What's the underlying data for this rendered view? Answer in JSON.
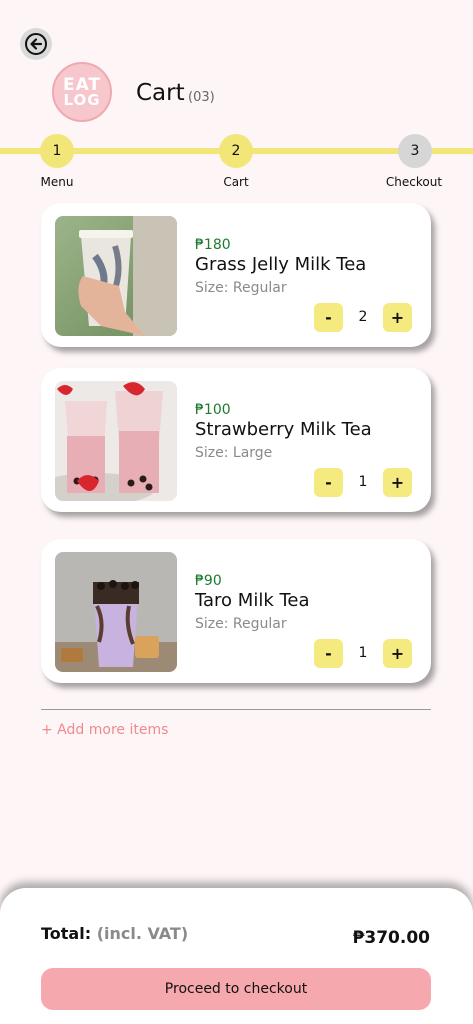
{
  "header": {
    "back_icon": "arrow-left-icon",
    "logo_line1": "EAT",
    "logo_line2": "LOG",
    "title": "Cart",
    "count": "(03)"
  },
  "steps": [
    {
      "number": "1",
      "label": "Menu",
      "state": "complete"
    },
    {
      "number": "2",
      "label": "Cart",
      "state": "active"
    },
    {
      "number": "3",
      "label": "Checkout",
      "state": "pending"
    }
  ],
  "items": [
    {
      "price": "₱180",
      "name": "Grass Jelly Milk Tea",
      "size": "Size: Regular",
      "qty": "2",
      "minus": "-",
      "plus": "+"
    },
    {
      "price": "₱100",
      "name": "Strawberry Milk Tea",
      "size": "Size: Large",
      "qty": "1",
      "minus": "-",
      "plus": "+"
    },
    {
      "price": "₱90",
      "name": "Taro Milk Tea",
      "size": "Size: Regular",
      "qty": "1",
      "minus": "-",
      "plus": "+"
    }
  ],
  "add_more": "+ Add more items",
  "footer": {
    "total_label": "Total:",
    "total_note": "(incl. VAT)",
    "total_value": "₱370.00",
    "checkout_label": "Proceed to checkout"
  },
  "colors": {
    "background": "#fdf5f6",
    "accent_yellow": "#f2e678",
    "price_green": "#1d7a2e",
    "checkout_pink": "#f5a8ad",
    "add_more_pink": "#f08a90"
  }
}
